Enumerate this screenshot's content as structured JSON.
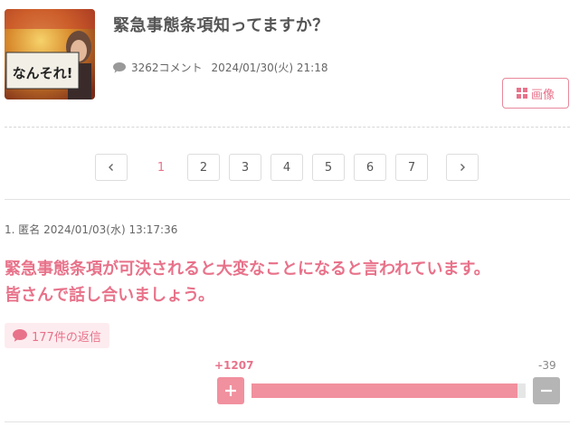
{
  "thread": {
    "title": "緊急事態条項知ってますか？",
    "comment_count": "3262コメント",
    "posted_at": "2024/01/30(火) 21:18",
    "image_button_label": "画像",
    "thumbnail_text": "なんそれ!"
  },
  "pagination": {
    "prev_icon": "chevron-left-icon",
    "next_icon": "chevron-right-icon",
    "current_page": 1,
    "pages": [
      "1",
      "2",
      "3",
      "4",
      "5",
      "6",
      "7"
    ]
  },
  "post": {
    "number": "1.",
    "author": "匿名",
    "timestamp": "2024/01/03(水) 13:17:36",
    "body_line1": "緊急事態条項が可決されると大変なことになると言われています。",
    "body_line2": "皆さんで話し合いましょう。",
    "reply_count": "177件の返信",
    "votes": {
      "plus_label": "+1207",
      "minus_label": "-39",
      "plus": 1207,
      "minus": 39
    }
  },
  "colors": {
    "accent": "#e8728a",
    "accent_soft": "#f1909e",
    "badge_bg": "#fdecef",
    "minus_gray": "#b5b5b5"
  }
}
